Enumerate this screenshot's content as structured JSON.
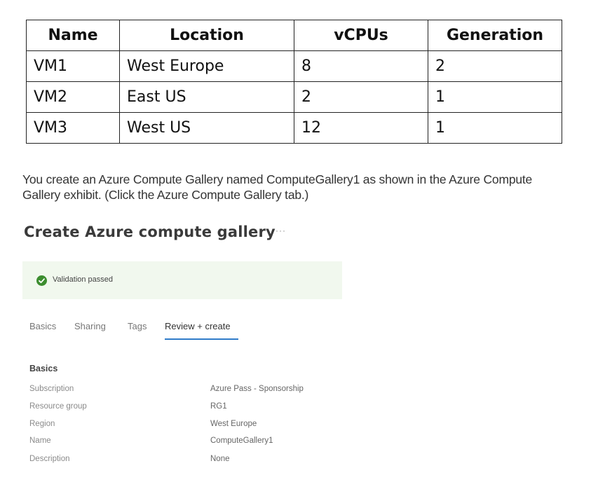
{
  "vm_table": {
    "headers": [
      "Name",
      "Location",
      "vCPUs",
      "Generation"
    ],
    "rows": [
      [
        "VM1",
        "West Europe",
        "8",
        "2"
      ],
      [
        "VM2",
        "East US",
        "2",
        "1"
      ],
      [
        "VM3",
        "West US",
        "12",
        "1"
      ]
    ]
  },
  "intro": {
    "text": "You create an Azure Compute Gallery named ComputeGallery1 as shown in the Azure Compute Gallery exhibit. (Click the Azure Compute Gallery tab.)"
  },
  "blade": {
    "title": "Create Azure compute gallery",
    "more_label": "···",
    "validation": {
      "icon": "check-circle-icon",
      "text": "Validation passed",
      "color": "#3c8d2f"
    },
    "tabs": [
      {
        "label": "Basics"
      },
      {
        "label": "Sharing"
      },
      {
        "label": "Tags"
      },
      {
        "label": "Review + create"
      }
    ],
    "active_tab_color": "#2f7cc9",
    "section_heading": "Basics",
    "fields": [
      {
        "label": "Subscription",
        "value": "Azure Pass - Sponsorship"
      },
      {
        "label": "Resource group",
        "value": "RG1"
      },
      {
        "label": "Region",
        "value": "West Europe"
      },
      {
        "label": "Name",
        "value": "ComputeGallery1"
      },
      {
        "label": "Description",
        "value": "None"
      }
    ]
  }
}
